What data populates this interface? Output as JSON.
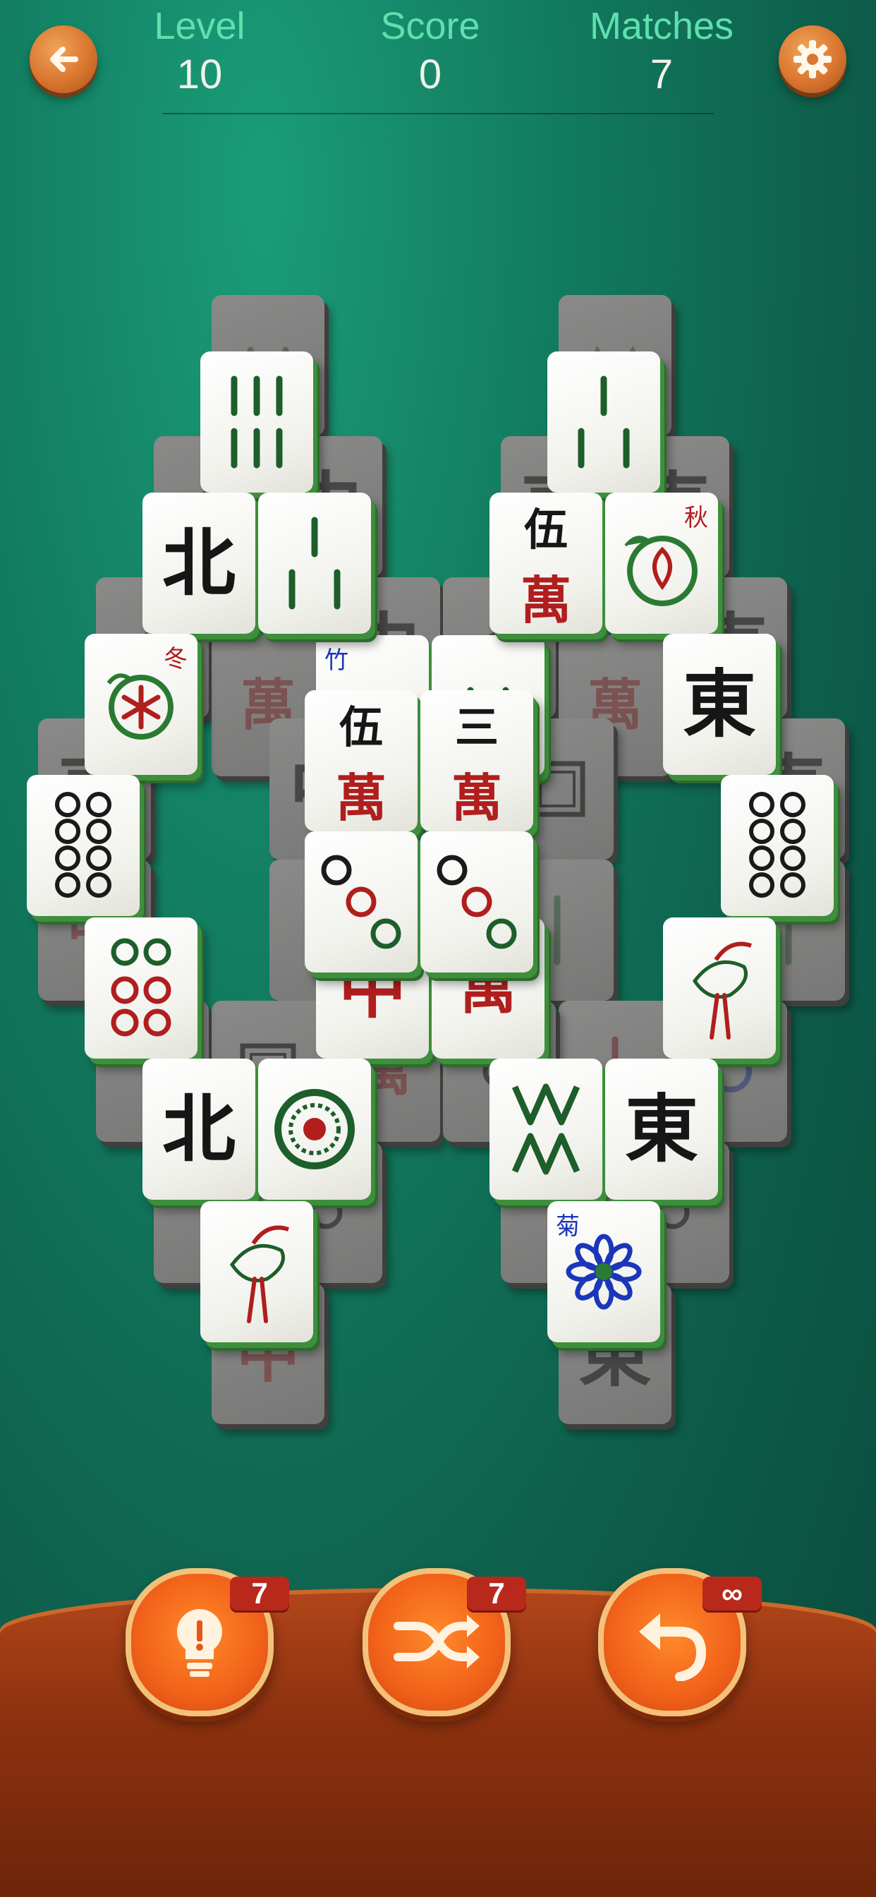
{
  "hud": {
    "level_label": "Level",
    "level_value": "10",
    "score_label": "Score",
    "score_value": "0",
    "matches_label": "Matches",
    "matches_value": "7",
    "back_icon": "arrow-left-icon",
    "settings_icon": "gear-icon"
  },
  "tiles": {
    "bamboo_6": "bamboo-6",
    "bamboo_3": "bamboo-3",
    "north": "北",
    "east": "東",
    "wan_five_top": "伍",
    "wan_three_top": "三",
    "wan_bottom": "萬",
    "zhong": "中",
    "season_autumn": "秋",
    "season_winter": "冬",
    "flower_bamboo": "竹",
    "flower_chrysanthemum": "菊",
    "bai": "白"
  },
  "powerups": {
    "hint_count": "7",
    "shuffle_count": "7",
    "undo_count": "∞"
  },
  "colors": {
    "felt": "#127a5e",
    "tile_edge": "#3e8f3c",
    "wood": "#8e3210",
    "button_orange": "#f2621a",
    "badge_red": "#b8281b",
    "hud_label": "#5fe0ae"
  }
}
